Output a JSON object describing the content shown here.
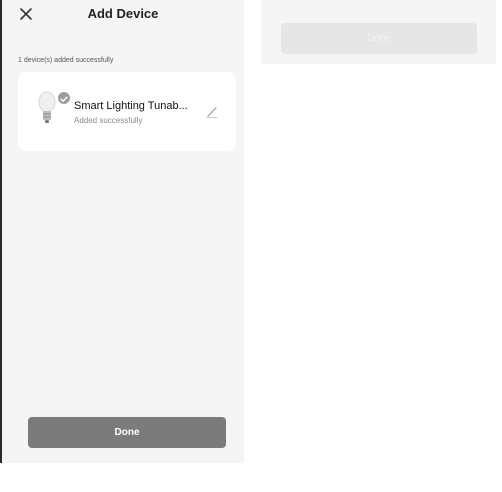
{
  "header": {
    "title": "Add Device"
  },
  "status_text": "1 device(s) added successfully",
  "device": {
    "name": "Smart Lighting Tunab...",
    "status": "Added successfully"
  },
  "done_label": "Done",
  "right_panel": {
    "done_label": "Done"
  }
}
